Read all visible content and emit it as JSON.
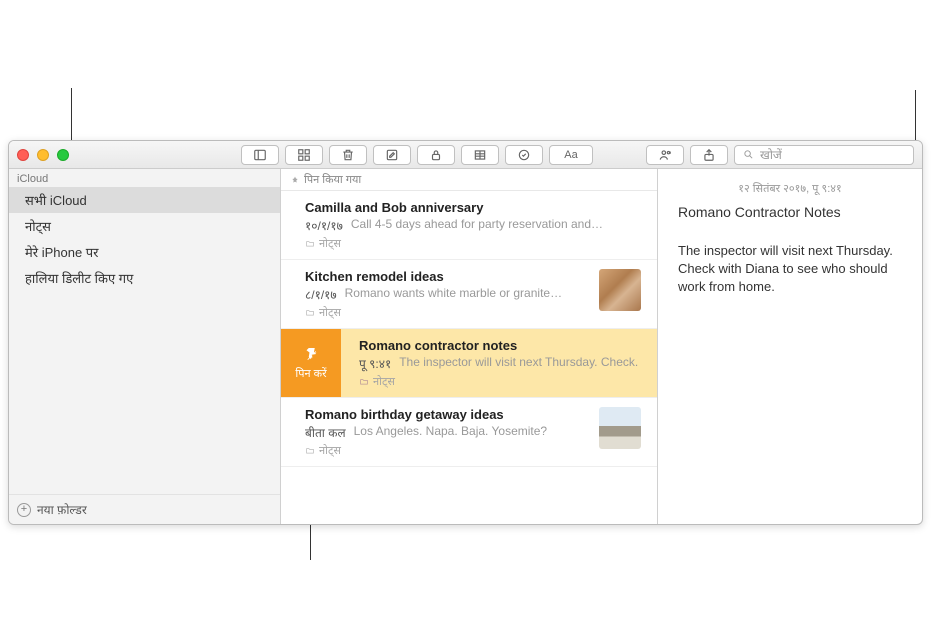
{
  "search": {
    "placeholder": "खोजें"
  },
  "sidebar": {
    "header": "iCloud",
    "items": [
      {
        "label": "सभी iCloud"
      },
      {
        "label": "नोट्स"
      },
      {
        "label": "मेरे iPhone पर"
      },
      {
        "label": "हालिया डिलीट किए गए"
      }
    ],
    "new_folder": "नया फ़ोल्डर"
  },
  "list": {
    "header": "पिन किया गया",
    "notes": [
      {
        "title": "Camilla and Bob anniversary",
        "date": "१०/१/१७",
        "snippet": "Call 4-5 days ahead for party reservation and…",
        "folder": "नोट्स"
      },
      {
        "title": "Kitchen remodel ideas",
        "date": "८/१/१७",
        "snippet": "Romano wants white marble or granite…",
        "folder": "नोट्स"
      },
      {
        "title": "Romano contractor notes",
        "date": "पू ९:४१",
        "snippet": "The inspector will visit next Thursday. Check.",
        "folder": "नोट्स"
      },
      {
        "title": "Romano birthday getaway ideas",
        "date": "बीता कल",
        "snippet": "Los Angeles. Napa. Baja. Yosemite?",
        "folder": "नोट्स"
      }
    ],
    "pin_action": "पिन करें"
  },
  "detail": {
    "date": "१२ सितंबर २०१७, पू ९:४१",
    "title": "Romano Contractor Notes",
    "body": "The inspector will visit next Thursday. Check with Diana to see who should work from home."
  }
}
